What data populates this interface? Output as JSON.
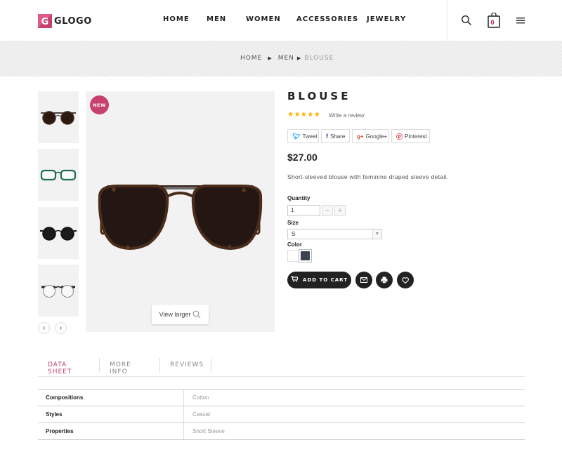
{
  "header": {
    "logo_text": "GLOGO",
    "logo_mark": "G",
    "nav": [
      "HOME",
      "MEN",
      "WOMEN",
      "ACCESSORIES",
      "JEWELRY"
    ],
    "cart_count": "0"
  },
  "breadcrumb": {
    "items": [
      "HOME",
      "MEN"
    ],
    "current": "BLOUSE"
  },
  "gallery": {
    "badge": "NEW",
    "view_larger": "View larger"
  },
  "product": {
    "title": "BLOUSE",
    "stars": "★★★★★",
    "rating": 5,
    "write_review": "Write a review",
    "share": {
      "tweet": "Tweet",
      "share": "Share",
      "google": "Google+",
      "pinterest": "Pinterest"
    },
    "price": "$27.00",
    "description": "Short-sleeved blouse with feminine draped sleeve detail.",
    "quantity_label": "Quantity",
    "quantity_value": "1",
    "size_label": "Size",
    "size_value": "S",
    "color_label": "Color",
    "colors": [
      "#ffffff",
      "#3b4352"
    ],
    "add_to_cart": "ADD TO CART"
  },
  "tabs": [
    "DATA SHEET",
    "MORE INFO",
    "REVIEWS"
  ],
  "data_sheet": [
    {
      "key": "Compositions",
      "value": "Cotton"
    },
    {
      "key": "Styles",
      "value": "Casual"
    },
    {
      "key": "Properties",
      "value": "Short Sleeve"
    }
  ],
  "colors": {
    "accent": "#c6416c",
    "star": "#f7b500",
    "dark": "#222222"
  }
}
